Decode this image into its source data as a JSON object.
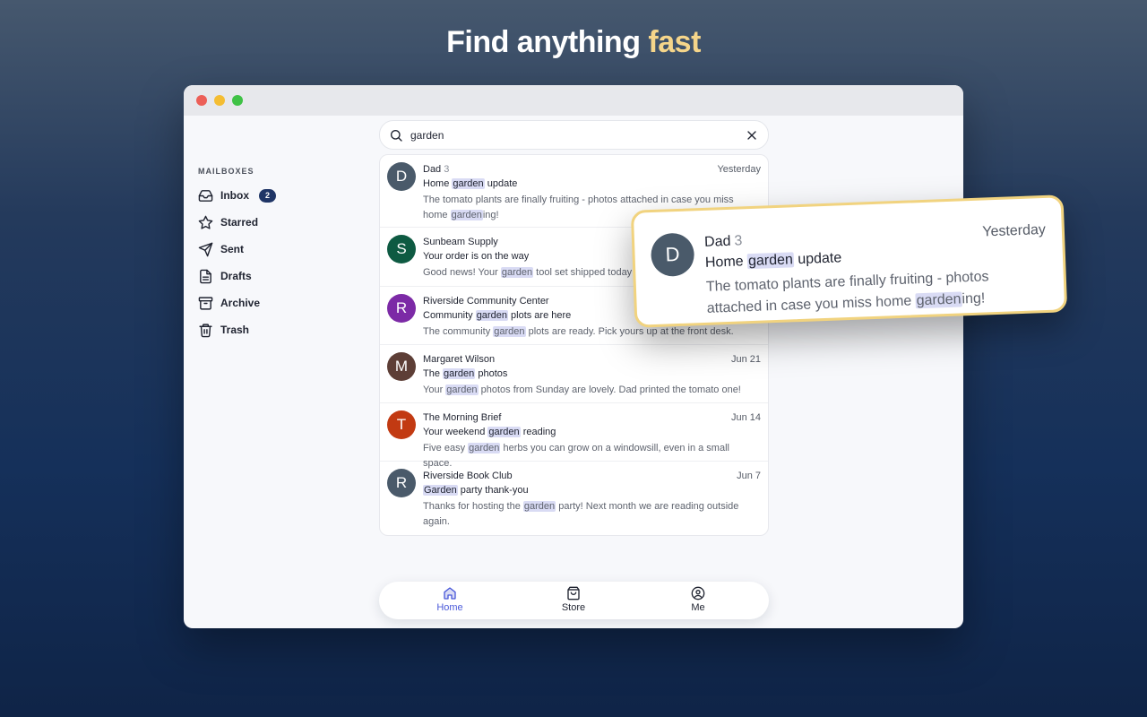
{
  "headline": {
    "text": "Find anything ",
    "accent": "fast",
    "accent_color": "#f5d58a"
  },
  "sidebar": {
    "heading": "MAILBOXES",
    "items": [
      {
        "label": "Inbox",
        "icon": "inbox-icon",
        "badge": "2"
      },
      {
        "label": "Starred",
        "icon": "star-icon"
      },
      {
        "label": "Sent",
        "icon": "send-icon"
      },
      {
        "label": "Drafts",
        "icon": "document-icon"
      },
      {
        "label": "Archive",
        "icon": "archive-icon"
      },
      {
        "label": "Trash",
        "icon": "trash-icon"
      }
    ]
  },
  "search": {
    "value": "garden",
    "placeholder": ""
  },
  "messages": [
    {
      "initial": "D",
      "color": "#4a5a6a",
      "sender": "Dad",
      "count": "3",
      "date": "Yesterday",
      "subject": [
        "Home ",
        "garden",
        " update"
      ],
      "preview": [
        "The tomato plants are finally fruiting - photos attached in case you miss home ",
        "garden",
        "ing!"
      ]
    },
    {
      "initial": "S",
      "color": "#0e5a42",
      "sender": "Sunbeam Supply",
      "count": "",
      "date": "",
      "subject": [
        "Your order is on the way",
        "",
        ""
      ],
      "preview": [
        "Good news! Your ",
        "garden",
        " tool set shipped today"
      ]
    },
    {
      "initial": "R",
      "color": "#7c2aa6",
      "sender": "Riverside Community Center",
      "count": "",
      "date": "",
      "subject": [
        "Community ",
        "garden",
        " plots are here"
      ],
      "preview": [
        "The community ",
        "garden",
        " plots are ready. Pick yours up at the front desk."
      ]
    },
    {
      "initial": "M",
      "color": "#5d3e36",
      "sender": "Margaret Wilson",
      "count": "",
      "date": "Jun 21",
      "subject": [
        "The ",
        "garden",
        " photos"
      ],
      "preview": [
        "Your ",
        "garden",
        " photos from Sunday are lovely. Dad printed the tomato one!"
      ]
    },
    {
      "initial": "T",
      "color": "#c23a12",
      "sender": "The Morning Brief",
      "count": "",
      "date": "Jun 14",
      "subject": [
        "Your weekend ",
        "garden",
        " reading"
      ],
      "preview": [
        "Five easy ",
        "garden",
        " herbs you can grow on a windowsill, even in a small space."
      ]
    },
    {
      "initial": "R",
      "color": "#4a5a6a",
      "sender": "Riverside Book Club",
      "count": "",
      "date": "Jun 7",
      "subject": [
        "",
        "Garden",
        " party thank-you"
      ],
      "preview": [
        "Thanks for hosting the ",
        "garden",
        " party! Next month we are reading outside again."
      ]
    }
  ],
  "tabs": [
    {
      "label": "Home",
      "icon": "home-icon",
      "active": true
    },
    {
      "label": "Store",
      "icon": "bag-icon",
      "active": false
    },
    {
      "label": "Me",
      "icon": "user-circle-icon",
      "active": false
    }
  ],
  "callout": {
    "initial": "D",
    "color": "#4a5a6a",
    "sender": "Dad",
    "count": "3",
    "date": "Yesterday",
    "subject": [
      "Home ",
      "garden",
      " update"
    ],
    "preview": [
      "The tomato plants are finally fruiting - photos attached in case you miss home ",
      "garden",
      "ing!"
    ]
  }
}
